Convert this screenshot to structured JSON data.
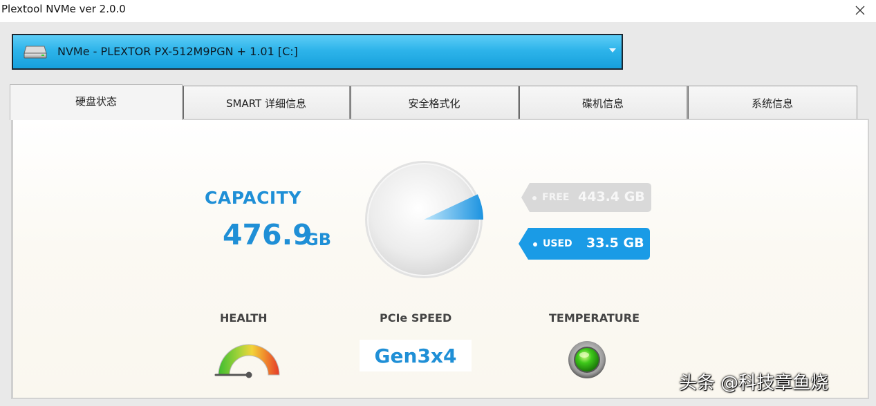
{
  "window": {
    "title": "Plextool NVMe ver 2.0.0"
  },
  "device_selector": {
    "value": "NVMe - PLEXTOR PX-512M9PGN + 1.01 [C:]",
    "icon": "drive-icon"
  },
  "tabs": [
    {
      "label": "硬盘状态",
      "active": true
    },
    {
      "label": "SMART 详细信息",
      "active": false
    },
    {
      "label": "安全格式化",
      "active": false
    },
    {
      "label": "碟机信息",
      "active": false
    },
    {
      "label": "系统信息",
      "active": false
    }
  ],
  "capacity": {
    "title": "CAPACITY",
    "value": "476.9",
    "unit": "GB",
    "used_fraction": 0.07
  },
  "free": {
    "label": "FREE",
    "value": "443.4 GB"
  },
  "used": {
    "label": "USED",
    "value": "33.5 GB"
  },
  "health": {
    "title": "HEALTH",
    "level": 1.0
  },
  "pcie": {
    "title": "PCIe SPEED",
    "value": "Gen3x4"
  },
  "temperature": {
    "title": "TEMPERATURE",
    "status_color": "#3ec81a"
  },
  "colors": {
    "accent": "#1f8fd6",
    "selector": "#2eb4ea",
    "used_pill": "#1a9be6",
    "free_pill": "#d9d9d9"
  },
  "watermark": "头条 @科技章鱼烧"
}
